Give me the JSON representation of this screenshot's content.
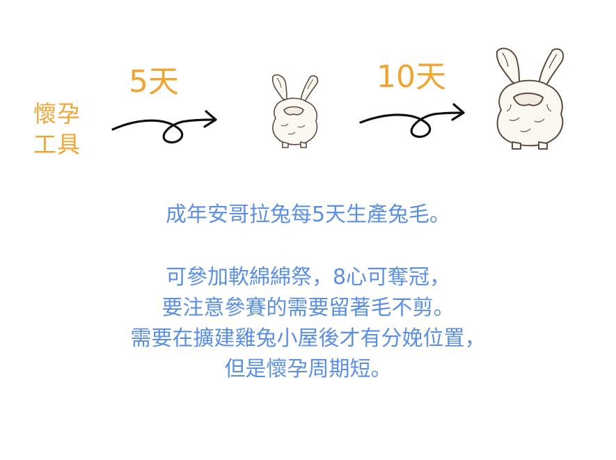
{
  "tool": {
    "line1": "懷孕",
    "line2": "工具"
  },
  "stages": [
    {
      "label": "5天"
    },
    {
      "label": "10天"
    }
  ],
  "summary": "成年安哥拉兔每5天生產兔毛。",
  "details": [
    "可參加軟綿綿祭，8心可奪冠，",
    "要注意參賽的需要留著毛不剪。",
    "需要在擴建雞兔小屋後才有分娩位置，",
    "但是懷孕周期短。"
  ],
  "colors": {
    "orange": "#f0a431",
    "blue": "#5b8fe2",
    "ink": "#111111"
  },
  "icons": [
    "small-angora-rabbit-icon",
    "large-angora-rabbit-icon",
    "curved-arrow-icon"
  ]
}
